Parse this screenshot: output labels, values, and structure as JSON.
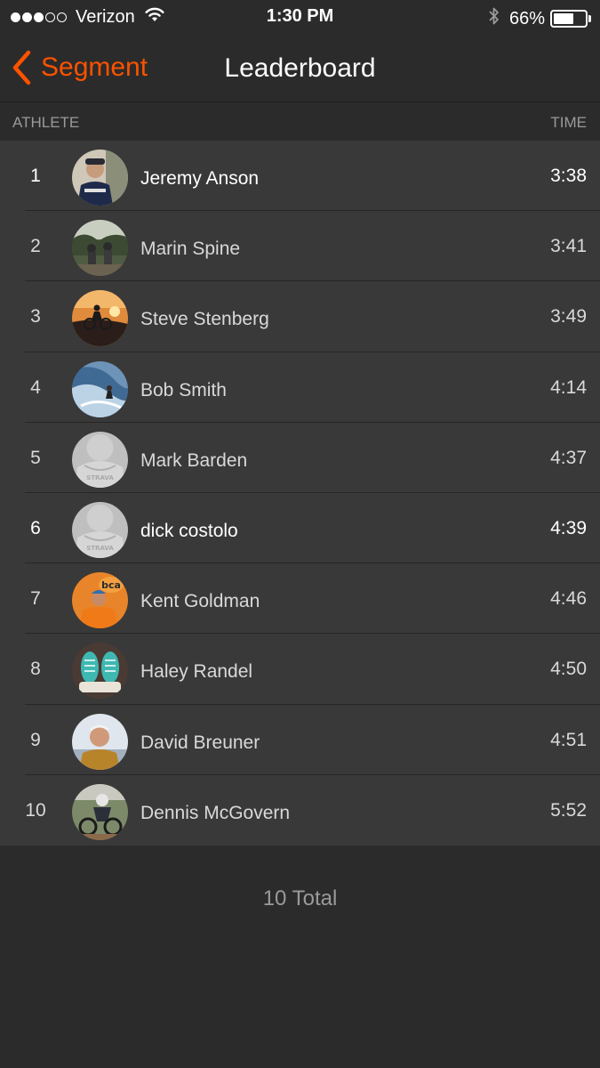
{
  "status_bar": {
    "carrier": "Verizon",
    "time": "1:30 PM",
    "battery": "66%",
    "battery_level": 0.66,
    "signal_bars_filled": 3,
    "signal_bars_total": 5
  },
  "nav": {
    "back_label": "Segment",
    "title": "Leaderboard"
  },
  "columns": {
    "athlete": "ATHLETE",
    "time": "TIME"
  },
  "colors": {
    "accent": "#fc5200",
    "background": "#2b2b2b",
    "row_background": "#393939"
  },
  "athletes": [
    {
      "rank": "1",
      "name": "Jeremy Anson",
      "time": "3:38",
      "avatar": "photo-cyclist-kit",
      "is_self": true
    },
    {
      "rank": "2",
      "name": "Marin Spine",
      "time": "3:41",
      "avatar": "photo-riders-trail",
      "is_self": false
    },
    {
      "rank": "3",
      "name": "Steve Stenberg",
      "time": "3:49",
      "avatar": "photo-sunset-rider",
      "is_self": false
    },
    {
      "rank": "4",
      "name": "Bob Smith",
      "time": "4:14",
      "avatar": "photo-surfer-wave",
      "is_self": false
    },
    {
      "rank": "5",
      "name": "Mark Barden",
      "time": "4:37",
      "avatar": "strava-default-avatar",
      "is_self": false
    },
    {
      "rank": "6",
      "name": "dick costolo",
      "time": "4:39",
      "avatar": "strava-default-avatar",
      "is_self": true
    },
    {
      "rank": "7",
      "name": "Kent Goldman",
      "time": "4:46",
      "avatar": "photo-orange-jacket",
      "is_self": false
    },
    {
      "rank": "8",
      "name": "Haley Randel",
      "time": "4:50",
      "avatar": "photo-teal-sneakers",
      "is_self": false
    },
    {
      "rank": "9",
      "name": "David Breuner",
      "time": "4:51",
      "avatar": "photo-man-portrait",
      "is_self": false
    },
    {
      "rank": "10",
      "name": "Dennis McGovern",
      "time": "5:52",
      "avatar": "photo-mtb-race",
      "is_self": false
    }
  ],
  "footer": {
    "total_label": "10 Total"
  }
}
